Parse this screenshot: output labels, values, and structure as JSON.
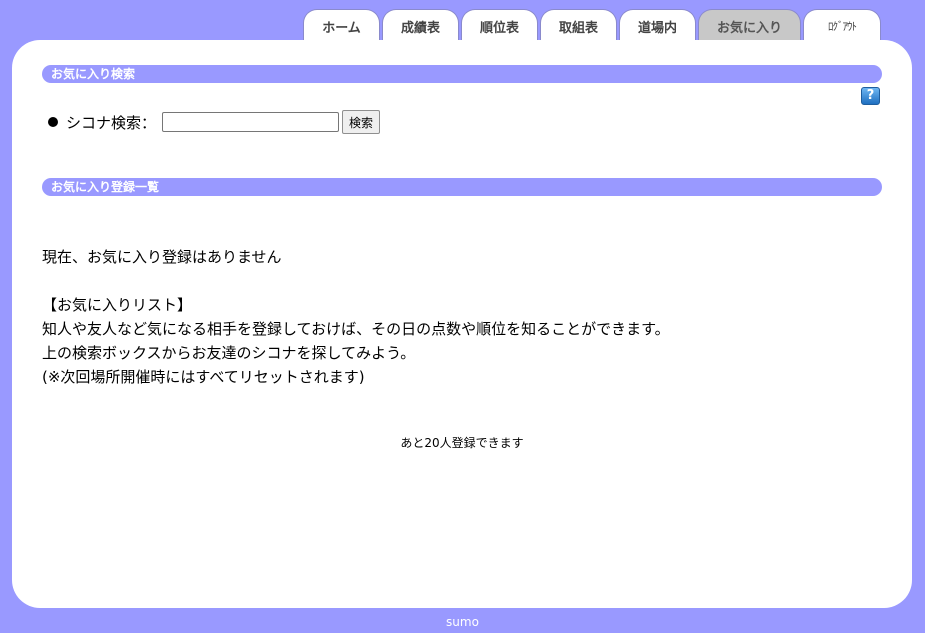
{
  "tabs": [
    {
      "label": "ホーム",
      "width": 77,
      "active": false
    },
    {
      "label": "成績表",
      "width": 77,
      "active": false
    },
    {
      "label": "順位表",
      "width": 77,
      "active": false
    },
    {
      "label": "取組表",
      "width": 77,
      "active": false
    },
    {
      "label": "道場内",
      "width": 77,
      "active": false
    },
    {
      "label": "お気に入り",
      "width": 103,
      "active": true
    },
    {
      "label": "ﾛｸﾞｱｳﾄ",
      "width": 78,
      "active": false
    }
  ],
  "favorite_search": {
    "heading": "お気に入り検索",
    "field_label": "シコナ検索：",
    "input_value": "",
    "button_label": "検索",
    "help_icon": "?"
  },
  "favorite_list": {
    "heading": "お気に入り登録一覧",
    "empty_message": "現在、お気に入り登録はありません",
    "info_title": "【お気に入りリスト】",
    "info_line1": "知人や友人など気になる相手を登録しておけば、その日の点数や順位を知ることができます。",
    "info_line2": "上の検索ボックスからお友達のシコナを探してみよう。",
    "info_line3": "(※次回場所開催時にはすべてリセットされます)",
    "remaining": "あと20人登録できます"
  },
  "footer": {
    "text": "sumo"
  }
}
